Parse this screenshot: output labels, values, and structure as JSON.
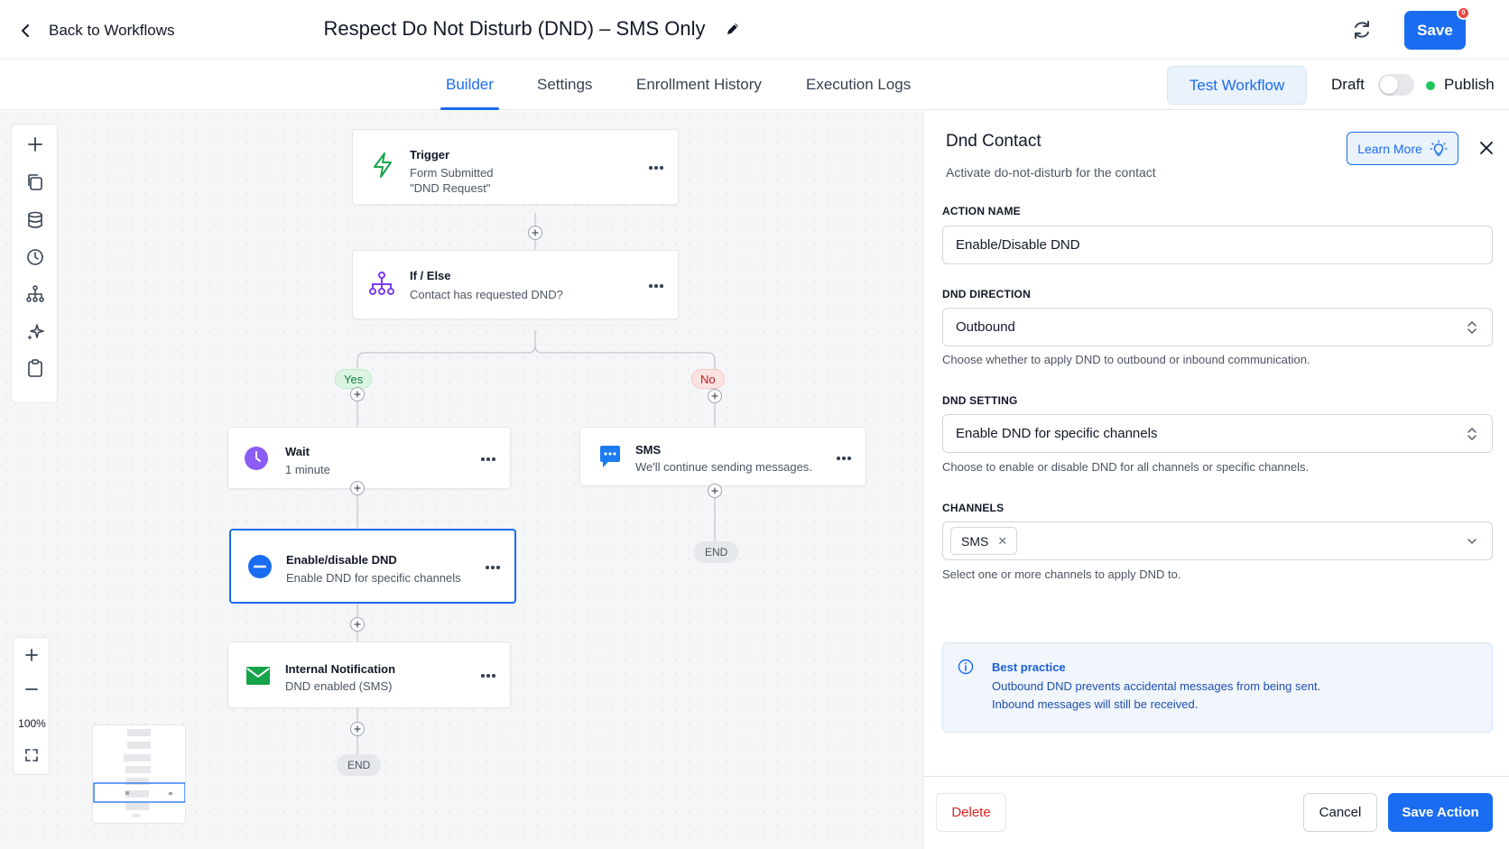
{
  "header": {
    "back_label": "Back to Workflows",
    "title": "Respect Do Not Disturb (DND) – SMS Only",
    "save_label": "Save",
    "save_badge": "0"
  },
  "tabs": [
    {
      "label": "Builder",
      "active": true
    },
    {
      "label": "Settings",
      "active": false
    },
    {
      "label": "Enrollment History",
      "active": false
    },
    {
      "label": "Execution Logs",
      "active": false
    }
  ],
  "toolbar": {
    "test_label": "Test Workflow",
    "draft_label": "Draft",
    "publish_label": "Publish",
    "publish_toggle_on": false
  },
  "canvas": {
    "nodes": {
      "trigger": {
        "title": "Trigger",
        "line1": "Form Submitted",
        "line2": "\"DND Request\"",
        "icon": "lightning-icon"
      },
      "ifelse": {
        "title": "If / Else",
        "line1": "Contact has requested DND?",
        "icon": "branch-icon"
      },
      "wait": {
        "title": "Wait",
        "line1": "1 minute",
        "icon": "clock-icon"
      },
      "sms": {
        "title": "SMS",
        "line1": "We'll continue sending messages.",
        "icon": "chat-icon"
      },
      "dnd": {
        "title": "Enable/disable DND",
        "line1": "Enable DND for specific channels",
        "icon": "minus-circle-icon"
      },
      "notify": {
        "title": "Internal Notification",
        "line1": "DND enabled (SMS)",
        "icon": "envelope-icon"
      }
    },
    "branch_yes": "Yes",
    "branch_no": "No",
    "end_label": "END",
    "zoom_level": "100%"
  },
  "panel": {
    "title": "Dnd Contact",
    "description": "Activate do-not-disturb for the contact",
    "learn_more": "Learn More",
    "action_name": {
      "label": "ACTION NAME",
      "value": "Enable/Disable DND"
    },
    "dnd_direction": {
      "label": "DND DIRECTION",
      "value": "Outbound",
      "help": "Choose whether to apply DND to outbound or inbound communication."
    },
    "dnd_setting": {
      "label": "DND SETTING",
      "value": "Enable DND for specific channels",
      "help": "Choose to enable or disable DND for all channels or specific channels."
    },
    "channels": {
      "label": "CHANNELS",
      "chips": [
        "SMS"
      ],
      "help": "Select one or more channels to apply DND to."
    },
    "info": {
      "title": "Best practice",
      "line1": "Outbound DND prevents accidental messages from being sent.",
      "line2": "Inbound messages will still be received."
    },
    "delete_label": "Delete",
    "cancel_label": "Cancel",
    "save_action_label": "Save Action"
  },
  "colors": {
    "accent": "#1a6cf0",
    "trigger_green": "#16a34a",
    "branch_purple": "#7c3aed",
    "delete_red": "#dc2626"
  }
}
